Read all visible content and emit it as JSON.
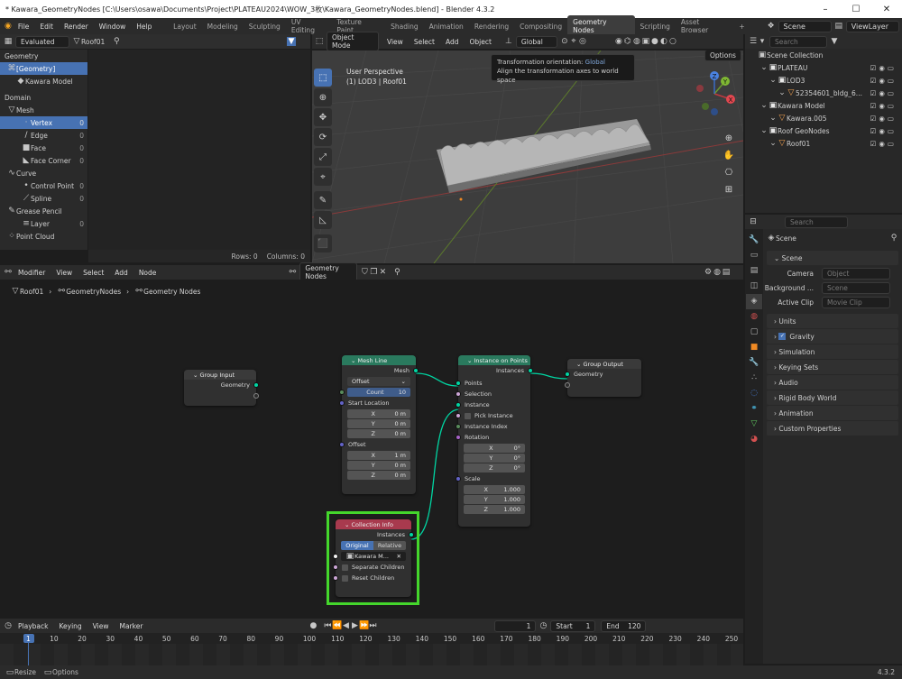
{
  "window": {
    "title": "* Kawara_GeometryNodes [C:\\Users\\osawa\\Documents\\Project\\PLATEAU2024\\WOW_3枚\\Kawara_GeometryNodes.blend] - Blender 4.3.2"
  },
  "menu": [
    "File",
    "Edit",
    "Render",
    "Window",
    "Help"
  ],
  "workspaces": [
    "Layout",
    "Modeling",
    "Sculpting",
    "UV Editing",
    "Texture Paint",
    "Shading",
    "Animation",
    "Rendering",
    "Compositing",
    "Geometry Nodes",
    "Scripting",
    "Asset Browser"
  ],
  "active_workspace_index": 9,
  "scene_name": "Scene",
  "view_layer": "ViewLayer",
  "spreadsheet": {
    "mode": "Evaluated",
    "object": "Roof01",
    "geometry_label": "Geometry",
    "geometry_item": "[Geometry]",
    "model_item": "Kawara Model",
    "domain_label": "Domain",
    "mesh_label": "Mesh",
    "mesh_items": [
      {
        "label": "Vertex",
        "count": "0"
      },
      {
        "label": "Edge",
        "count": "0"
      },
      {
        "label": "Face",
        "count": "0"
      },
      {
        "label": "Face Corner",
        "count": "0"
      }
    ],
    "curve_label": "Curve",
    "curve_items": [
      {
        "label": "Control Point",
        "count": "0"
      },
      {
        "label": "Spline",
        "count": "0"
      }
    ],
    "grease_label": "Grease Pencil",
    "grease_items": [
      {
        "label": "Layer",
        "count": "0"
      }
    ],
    "pointcloud_label": "Point Cloud",
    "rows": "Rows: 0",
    "columns": "Columns: 0"
  },
  "viewport": {
    "mode": "Object Mode",
    "menus": [
      "View",
      "Select",
      "Add",
      "Object"
    ],
    "orientation": "Global",
    "options": "Options",
    "perspective": "User Perspective",
    "object_info": "(1) LOD3 | Roof01",
    "tooltip_title": "Transformation orientation:",
    "tooltip_value": "Global",
    "tooltip_desc": "Align the transformation axes to world space",
    "axes": {
      "x": "X",
      "y": "Y",
      "z": "Z"
    }
  },
  "outliner": {
    "title": "Scene Collection",
    "search_placeholder": "Search",
    "items": [
      {
        "label": "PLATEAU",
        "indent": 1,
        "icon": "collection"
      },
      {
        "label": "LOD3",
        "indent": 2,
        "icon": "collection"
      },
      {
        "label": "52354601_bldg_6...",
        "indent": 3,
        "icon": "mesh"
      },
      {
        "label": "Kawara Model",
        "indent": 1,
        "icon": "collection"
      },
      {
        "label": "Kawara.005",
        "indent": 2,
        "icon": "mesh"
      },
      {
        "label": "Roof GeoNodes",
        "indent": 1,
        "icon": "collection"
      },
      {
        "label": "Roof01",
        "indent": 2,
        "icon": "mesh"
      }
    ]
  },
  "properties": {
    "search_placeholder": "Search",
    "context": "Scene",
    "scene_label": "Scene",
    "camera_label": "Camera",
    "camera_placeholder": "Object",
    "background_label": "Background ...",
    "background_placeholder": "Scene",
    "clip_label": "Active Clip",
    "clip_placeholder": "Movie Clip",
    "sections": [
      "Units",
      "Gravity",
      "Simulation",
      "Keying Sets",
      "Audio",
      "Rigid Body World",
      "Animation",
      "Custom Properties"
    ]
  },
  "node_editor": {
    "menus": [
      "Modifier",
      "View",
      "Select",
      "Add",
      "Node"
    ],
    "tree_name": "Geometry Nodes",
    "breadcrumb": [
      "Roof01",
      "GeometryNodes",
      "Geometry Nodes"
    ]
  },
  "nodes": {
    "group_input": {
      "title": "Group Input",
      "geometry": "Geometry"
    },
    "mesh_line": {
      "title": "Mesh Line",
      "mesh": "Mesh",
      "mode": "Offset",
      "count_label": "Count",
      "count": "10",
      "start_label": "Start Location",
      "start": [
        {
          "l": "X",
          "v": "0 m"
        },
        {
          "l": "Y",
          "v": "0 m"
        },
        {
          "l": "Z",
          "v": "0 m"
        }
      ],
      "offset_label": "Offset",
      "offset": [
        {
          "l": "X",
          "v": "1 m"
        },
        {
          "l": "Y",
          "v": "0 m"
        },
        {
          "l": "Z",
          "v": "0 m"
        }
      ]
    },
    "instance_on_points": {
      "title": "Instance on Points",
      "instances": "Instances",
      "points": "Points",
      "selection": "Selection",
      "instance": "Instance",
      "pick": "Pick Instance",
      "index": "Instance Index",
      "rotation": "Rotation",
      "rot": [
        {
          "l": "X",
          "v": "0°"
        },
        {
          "l": "Y",
          "v": "0°"
        },
        {
          "l": "Z",
          "v": "0°"
        }
      ],
      "scale": "Scale",
      "sc": [
        {
          "l": "X",
          "v": "1.000"
        },
        {
          "l": "Y",
          "v": "1.000"
        },
        {
          "l": "Z",
          "v": "1.000"
        }
      ]
    },
    "group_output": {
      "title": "Group Output",
      "geometry": "Geometry"
    },
    "collection_info": {
      "title": "Collection Info",
      "instances": "Instances",
      "original": "Original",
      "relative": "Relative",
      "collection": "Kawara M...",
      "separate": "Separate Children",
      "reset": "Reset Children"
    }
  },
  "timeline": {
    "menus": [
      "Playback",
      "Keying",
      "View",
      "Marker"
    ],
    "current_frame": "1",
    "start_label": "Start",
    "start": "1",
    "end_label": "End",
    "end": "120",
    "ticks": [
      "1",
      "10",
      "20",
      "30",
      "40",
      "50",
      "60",
      "70",
      "80",
      "90",
      "100",
      "110",
      "120",
      "130",
      "140",
      "150",
      "160",
      "170",
      "180",
      "190",
      "200",
      "210",
      "220",
      "230",
      "240",
      "250"
    ]
  },
  "statusbar": {
    "resize": "Resize",
    "options": "Options",
    "version": "4.3.2"
  },
  "colors": {
    "accent": "#4772b3",
    "highlight_box": "#44d62c",
    "mesh_line_header": "#2a7a5e",
    "collection_header": "#a83a4e"
  }
}
